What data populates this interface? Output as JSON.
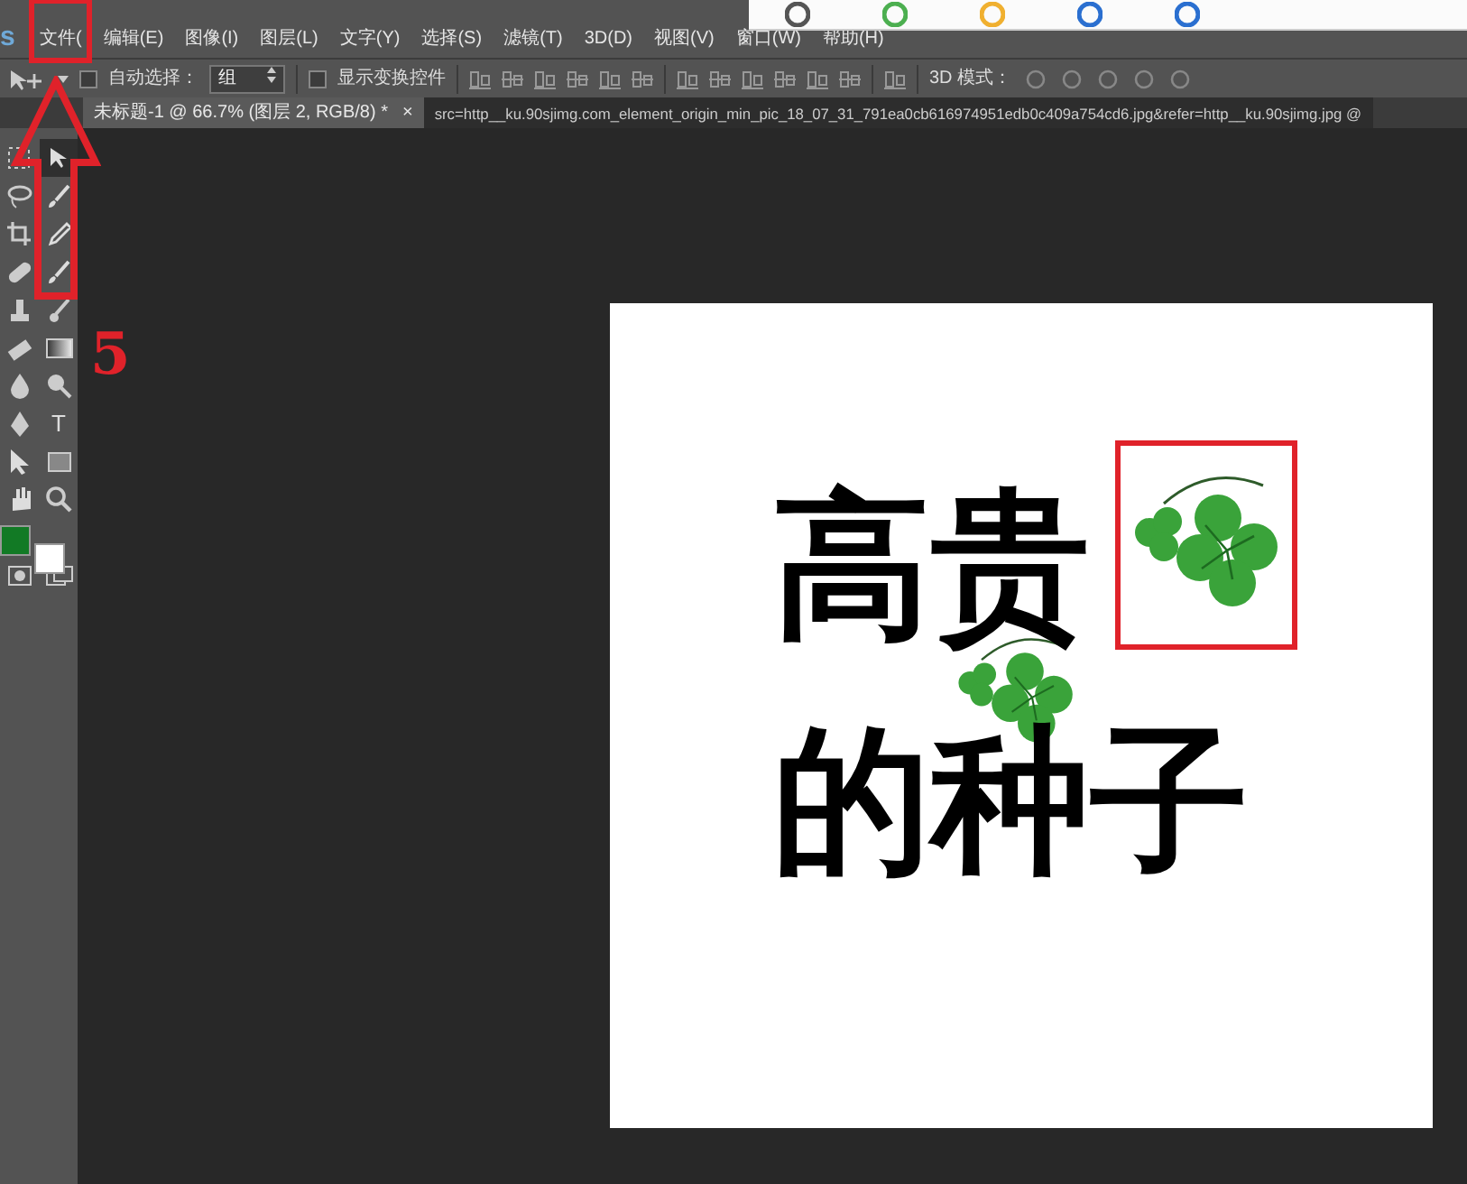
{
  "app": {
    "logo": "s"
  },
  "menu": [
    {
      "label": "文件(",
      "highlighted": true
    },
    {
      "label": "编辑(E)",
      "highlighted": false
    },
    {
      "label": "图像(I)",
      "highlighted": false
    },
    {
      "label": "图层(L)",
      "highlighted": false
    },
    {
      "label": "文字(Y)",
      "highlighted": false
    },
    {
      "label": "选择(S)",
      "highlighted": false
    },
    {
      "label": "滤镜(T)",
      "highlighted": false
    },
    {
      "label": "3D(D)",
      "highlighted": false
    },
    {
      "label": "视图(V)",
      "highlighted": false
    },
    {
      "label": "窗口(W)",
      "highlighted": false
    },
    {
      "label": "帮助(H)",
      "highlighted": false
    }
  ],
  "options_bar": {
    "auto_select": {
      "label": "自动选择：",
      "checked": false
    },
    "select_value": "组",
    "show_transform": {
      "label": "显示变换控件",
      "checked": false
    },
    "mode_label": "3D 模式："
  },
  "tabs": [
    {
      "label": "未标题-1 @ 66.7% (图层 2, RGB/8) *",
      "close": "×",
      "selected": true
    },
    {
      "label": "src=http__ku.90sjimg.com_element_origin_min_pic_18_07_31_791ea0cb616974951edb0c409a754cd6.jpg&refer=http__ku.90sjimg.jpg @",
      "selected": false
    }
  ],
  "tools": [
    {
      "kind": "marquee",
      "selected": false
    },
    {
      "kind": "move",
      "selected": true
    },
    {
      "kind": "lasso",
      "selected": false
    },
    {
      "kind": "brush",
      "selected": false
    },
    {
      "kind": "crop",
      "selected": false
    },
    {
      "kind": "eyedropper",
      "selected": false
    },
    {
      "kind": "bandage",
      "selected": false
    },
    {
      "kind": "brush",
      "selected": false
    },
    {
      "kind": "stamp",
      "selected": false
    },
    {
      "kind": "history",
      "selected": false
    },
    {
      "kind": "eraser",
      "selected": false
    },
    {
      "kind": "gradient",
      "selected": false
    },
    {
      "kind": "drop",
      "selected": false
    },
    {
      "kind": "dodge",
      "selected": false
    },
    {
      "kind": "pen",
      "selected": false
    },
    {
      "kind": "text",
      "label": "T",
      "selected": false
    },
    {
      "kind": "pointer",
      "selected": false
    },
    {
      "kind": "rectangle",
      "selected": false
    },
    {
      "kind": "hand",
      "selected": false
    },
    {
      "kind": "zoom",
      "selected": false
    }
  ],
  "swatches": [
    {
      "color": "#127a25"
    },
    {
      "color": "#ffffff"
    }
  ],
  "canvas": {
    "lines": [
      "高贵",
      "的种子"
    ]
  },
  "annotation": {
    "step": "5"
  }
}
